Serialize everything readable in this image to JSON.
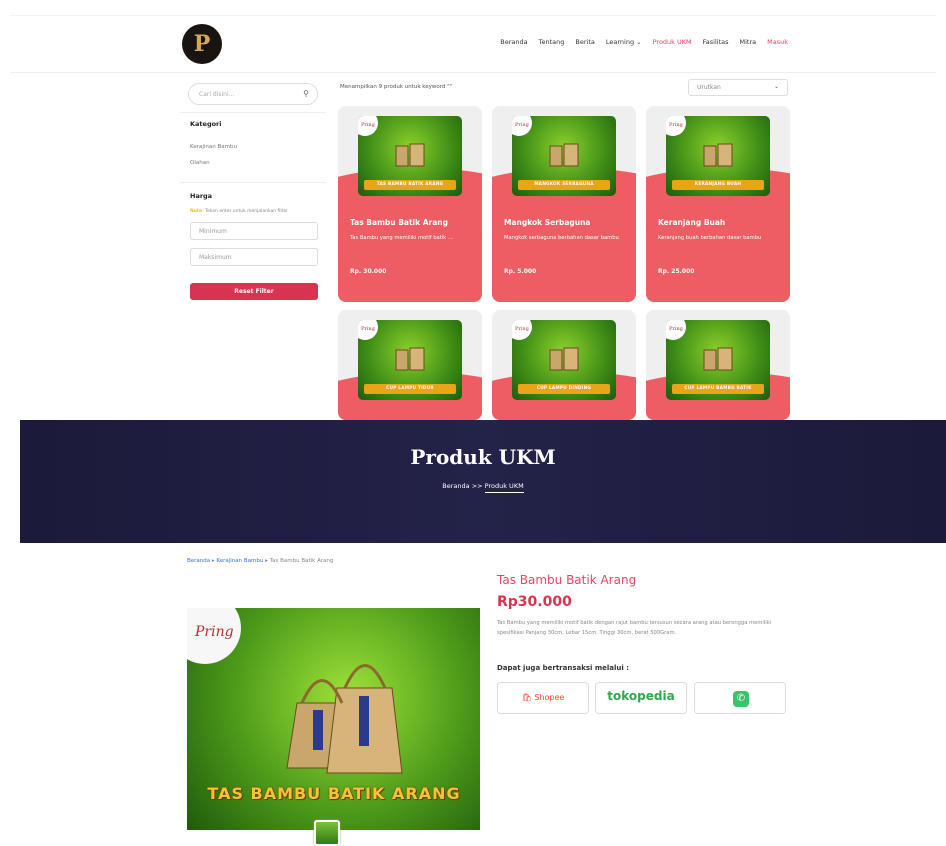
{
  "nav": {
    "items": [
      "Beranda",
      "Tentang",
      "Berita",
      "Learning ⌄",
      "Produk UKM",
      "Fasilitas",
      "Mitra",
      "Masuk"
    ]
  },
  "sidebar": {
    "search_placeholder": "Cari disini...",
    "kategori_title": "Kategori",
    "kategori_items": [
      "Kerajinan Bambu",
      "Olahan"
    ],
    "harga_title": "Harga",
    "note_prefix": "Note",
    "note_text": ": Tekan enter untuk menjalankan filter",
    "min_placeholder": "Minimum",
    "max_placeholder": "Maksimum",
    "reset_label": "Reset Filter"
  },
  "results": {
    "text": "Menampilkan 9 produk untuk keyword \"\"",
    "sort_label": "Urutkan"
  },
  "products": [
    {
      "ribbon": "TAS BAMBU BATIK ARANG",
      "name": "Tas Bambu Batik Arang",
      "desc": "Tas Bambu yang memiliki motif batik ...",
      "price": "Rp. 30.000"
    },
    {
      "ribbon": "MANGKOK SERBAGUNA",
      "name": "Mangkok Serbaguna",
      "desc": "Mangkok serbaguna berbahan dasar bambu",
      "price": "Rp. 5.000"
    },
    {
      "ribbon": "KERANJANG BUAH",
      "name": "Keranjang Buah",
      "desc": "Keranjang buah berbahan dasar bambu",
      "price": "Rp. 25.000"
    },
    {
      "ribbon": "CUP LAMPU TIDUR",
      "name": "",
      "desc": "",
      "price": ""
    },
    {
      "ribbon": "CUP LAMPU DINDING",
      "name": "",
      "desc": "",
      "price": ""
    },
    {
      "ribbon": "CUP LAMPU BAMBU BATIK",
      "name": "",
      "desc": "",
      "price": ""
    }
  ],
  "banner": {
    "title": "Produk UKM",
    "crumb_home": "Beranda",
    "crumb_sep": " >> ",
    "crumb_current": "Produk UKM"
  },
  "detail": {
    "breadcrumb": [
      "Beranda",
      "Kerajinan Bambu",
      "Tas Bambu Batik Arang"
    ],
    "image_ribbon": "TAS BAMBU BATIK ARANG",
    "brand": "Pring",
    "title": "Tas Bambu Batik Arang",
    "price": "Rp30.000",
    "description": "Tas Bambu yang memiliki motif batik dengan rajut bambu tersusun secara arang atau berongga memiliki spesifikasi Panjang 30cm, Lebar 15cm, Tinggi 30cm, berat 500Gram.",
    "also_label": "Dapat juga bertransaksi melalui :",
    "marketplaces": [
      "Shopee",
      "tokopedia",
      "WhatsApp"
    ]
  },
  "colors": {
    "accent": "#e94560",
    "card": "#ee5d63",
    "banner": "#1c1a3a"
  }
}
